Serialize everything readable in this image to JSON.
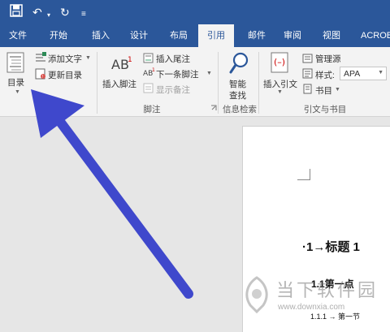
{
  "quick_access": {
    "save_icon": "save-icon",
    "undo_icon": "undo-icon",
    "redo_icon": "redo-icon",
    "customize_icon": "customize-icon"
  },
  "tabs": [
    {
      "label": "文件"
    },
    {
      "label": "开始"
    },
    {
      "label": "插入"
    },
    {
      "label": "设计"
    },
    {
      "label": "布局"
    },
    {
      "label": "引用"
    },
    {
      "label": "邮件"
    },
    {
      "label": "审阅"
    },
    {
      "label": "视图"
    },
    {
      "label": "ACROB"
    }
  ],
  "active_tab": "引用",
  "ribbon": {
    "toc": {
      "button_label": "目录",
      "add_text": "添加文字",
      "update_toc": "更新目录"
    },
    "footnotes": {
      "insert_footnote": "插入脚注",
      "insert_endnote": "插入尾注",
      "next_footnote": "下一条脚注",
      "show_notes": "显示备注",
      "group_label": "脚注"
    },
    "research": {
      "smart_lookup": "智能查找",
      "smart_lookup_l1": "智能",
      "smart_lookup_l2": "查找",
      "group_label": "信息检索"
    },
    "citations": {
      "insert_citation": "插入引文",
      "manage_sources": "管理源",
      "style_label": "样式:",
      "style_value": "APA",
      "bibliography": "书目",
      "group_label": "引文与书目"
    }
  },
  "document": {
    "heading1": "·1→标题 1",
    "heading2": "1.1第一点",
    "heading3": "1.1.1 → 第一节"
  },
  "watermark": {
    "line1": "当下软件园",
    "line2": "www.downxia.com"
  },
  "colors": {
    "ribbon_blue": "#2b579a",
    "arrow": "#3f48cc"
  }
}
